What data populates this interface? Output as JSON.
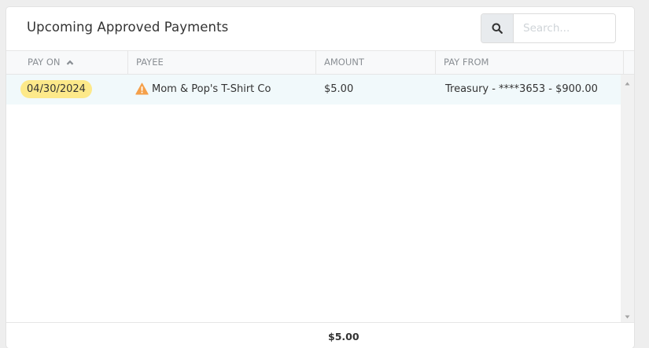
{
  "panel": {
    "title": "Upcoming Approved Payments"
  },
  "search": {
    "placeholder": "Search...",
    "value": "",
    "icon": "search-icon"
  },
  "table": {
    "columns": [
      {
        "key": "pay_on",
        "label": "PAY ON",
        "sorted": "ascending"
      },
      {
        "key": "payee",
        "label": "PAYEE"
      },
      {
        "key": "amount",
        "label": "AMOUNT"
      },
      {
        "key": "pay_from",
        "label": "PAY FROM"
      }
    ],
    "rows": [
      {
        "pay_on": "04/30/2024",
        "payee": "Mom & Pop's T-Shirt Co",
        "payee_icon": "warning-icon",
        "amount": "$5.00",
        "pay_from": "Treasury - ****3653 - $900.00"
      }
    ]
  },
  "footer": {
    "total": "$5.00"
  },
  "colors": {
    "date_badge": "#fde98a",
    "row_highlight": "#f1f9fb",
    "warning": "#f5a04a",
    "header_bg": "#f8f9fa"
  }
}
